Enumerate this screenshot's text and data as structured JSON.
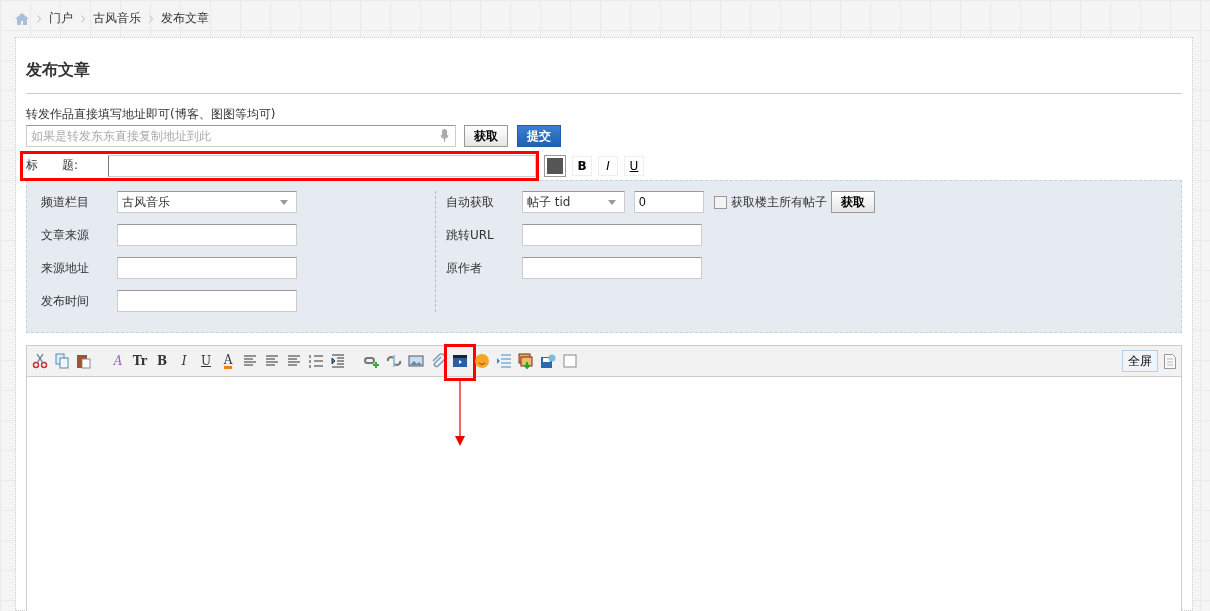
{
  "breadcrumb": [
    "门户",
    "古风音乐",
    "发布文章"
  ],
  "heading": "发布文章",
  "forward": {
    "label": "转发作品直接填写地址即可(博客、图图等均可)",
    "placeholder": "如果是转发东东直接复制地址到此",
    "fetch_button": "获取",
    "submit_button": "提交"
  },
  "title_row": {
    "label": "标　　题:",
    "format_buttons": [
      {
        "kind": "bold",
        "label": "B"
      },
      {
        "kind": "italic",
        "label": "I"
      },
      {
        "kind": "underline",
        "label": "U"
      }
    ]
  },
  "meta_left": [
    {
      "label": "频道栏目",
      "kind": "select",
      "value": "古风音乐"
    },
    {
      "label": "文章来源",
      "kind": "input"
    },
    {
      "label": "来源地址",
      "kind": "input"
    },
    {
      "label": "发布时间",
      "kind": "input"
    }
  ],
  "meta_right": [
    {
      "label": "自动获取",
      "kind": "auto",
      "select_value": "帖子 tid",
      "input_value": "0",
      "checkbox_label": "获取楼主所有帖子",
      "checked": false,
      "button": "获取"
    },
    {
      "label": "跳转URL",
      "kind": "input"
    },
    {
      "label": "原作者",
      "kind": "input"
    }
  ],
  "editor": {
    "tools": [
      {
        "kind": "cut"
      },
      {
        "kind": "copy"
      },
      {
        "kind": "paste"
      },
      {
        "kind": "gap"
      },
      {
        "kind": "font",
        "glyph": "A"
      },
      {
        "kind": "size",
        "glyph": "Tr"
      },
      {
        "kind": "bold",
        "glyph": "B"
      },
      {
        "kind": "italic",
        "glyph": "I"
      },
      {
        "kind": "underline",
        "glyph": "U"
      },
      {
        "kind": "color",
        "glyph": "A"
      },
      {
        "kind": "align"
      },
      {
        "kind": "align"
      },
      {
        "kind": "align"
      },
      {
        "kind": "list"
      },
      {
        "kind": "indent"
      },
      {
        "kind": "gap"
      },
      {
        "kind": "link"
      },
      {
        "kind": "unlink"
      },
      {
        "kind": "image"
      },
      {
        "kind": "attach"
      },
      {
        "kind": "video",
        "highlighted": true
      },
      {
        "kind": "emoji"
      },
      {
        "kind": "pagebreak"
      },
      {
        "kind": "download"
      },
      {
        "kind": "save"
      },
      {
        "kind": "checkbox"
      }
    ],
    "fullscreen_button": "全屏"
  }
}
